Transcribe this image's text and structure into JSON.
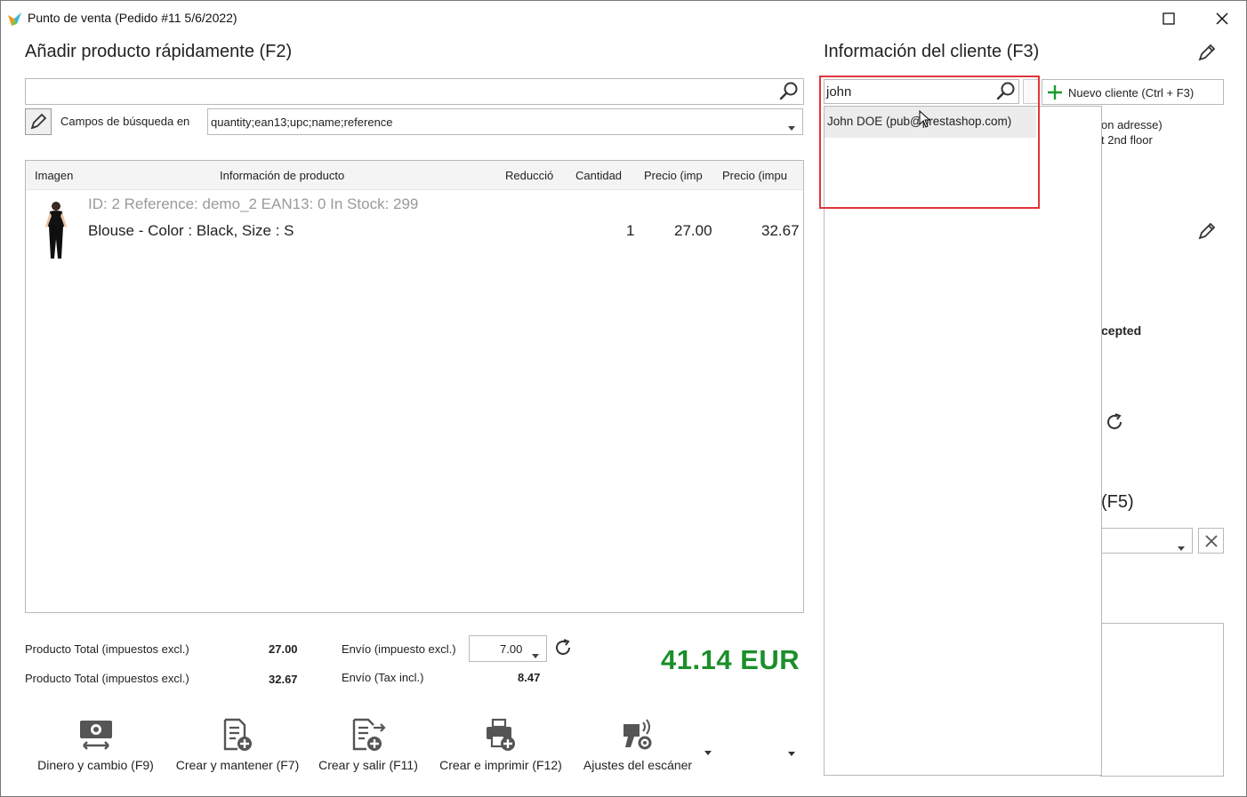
{
  "window": {
    "title": "Punto de venta (Pedido #11 5/6/2022)",
    "maximize_glyph": "☐",
    "close_glyph": "✕"
  },
  "product_section": {
    "title": "Añadir producto rápidamente (F2)",
    "search_value": "",
    "search_fields_label": "Campos de búsqueda en",
    "search_fields_value": "quantity;ean13;upc;name;reference"
  },
  "product_grid": {
    "columns": [
      "Imagen",
      "Información de producto",
      "Reducció",
      "Cantidad",
      "Precio (imp",
      "Precio (impu"
    ],
    "rows": [
      {
        "meta": "ID: 2 Reference: demo_2 EAN13: 0 In Stock: 299",
        "name": "Blouse - Color : Black, Size : S",
        "quantity": "1",
        "price_excl": "27.00",
        "price_incl": "32.67"
      }
    ]
  },
  "totals": {
    "product_total_excl_label": "Producto Total (impuestos excl.)",
    "product_total_excl_value": "27.00",
    "product_total_incl_label": "Producto Total (impuestos excl.)",
    "product_total_incl_value": "32.67",
    "shipping_excl_label": "Envío (impuesto excl.)",
    "shipping_excl_value": "7.00",
    "shipping_incl_label": "Envío (Tax incl.)",
    "shipping_incl_value": "8.47",
    "grand_total": "41.14 EUR",
    "grand_total_color": "#1a8f2a"
  },
  "toolbar": {
    "cash_label": "Dinero y cambio (F9)",
    "create_keep_label": "Crear y mantener (F7)",
    "create_exit_label": "Crear y salir (F11)",
    "create_print_label": "Crear e imprimir (F12)",
    "scanner_label": "Ajustes del escáner"
  },
  "customer_section": {
    "title": "Información del cliente (F3)",
    "search_value": "john",
    "new_customer_label": "Nuevo cliente (Ctrl + F3)",
    "suggestion": "John DOE (pub@prestashop.com)",
    "partial_address_1": "on adresse)",
    "partial_address_2": "t 2nd floor",
    "partial_accepted": "cepted",
    "partial_f5": "(F5)"
  },
  "colors": {
    "highlight": "#e0353b",
    "add_icon": "#1a9a2a"
  }
}
